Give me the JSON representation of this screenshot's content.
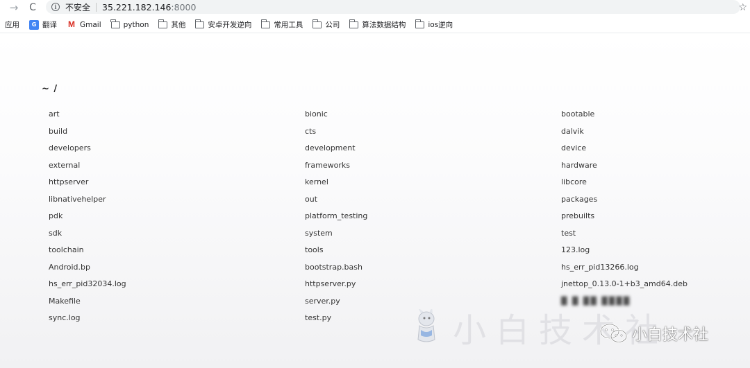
{
  "browser": {
    "forward_icon": "→",
    "reload_icon": "C",
    "info_icon": "i",
    "insecure_label": "不安全",
    "url_host": "35.221.182.146",
    "url_port": ":8000",
    "star_icon": "☆"
  },
  "bookmarks": [
    {
      "label": "应用",
      "icon": "none"
    },
    {
      "label": "翻译",
      "icon": "translate-icon"
    },
    {
      "label": "Gmail",
      "icon": "gmail-icon"
    },
    {
      "label": "python",
      "icon": "folder-icon"
    },
    {
      "label": "其他",
      "icon": "folder-icon"
    },
    {
      "label": "安卓开发逆向",
      "icon": "folder-icon"
    },
    {
      "label": "常用工具",
      "icon": "folder-icon"
    },
    {
      "label": "公司",
      "icon": "folder-icon"
    },
    {
      "label": "算法数据结构",
      "icon": "folder-icon"
    },
    {
      "label": "ios逆向",
      "icon": "folder-icon"
    }
  ],
  "page": {
    "title": "~ /",
    "entries": [
      "art",
      "bionic",
      "bootable",
      "build",
      "cts",
      "dalvik",
      "developers",
      "development",
      "device",
      "external",
      "frameworks",
      "hardware",
      "httpserver",
      "kernel",
      "libcore",
      "libnativehelper",
      "out",
      "packages",
      "pdk",
      "platform_testing",
      "prebuilts",
      "sdk",
      "system",
      "test",
      "toolchain",
      "tools",
      "123.log",
      "Android.bp",
      "bootstrap.bash",
      "hs_err_pid13266.log",
      "hs_err_pid32034.log",
      "httpserver.py",
      "jnettop_0.13.0-1+b3_amd64.deb",
      "Makefile",
      "server.py",
      "",
      "sync.log",
      "test.py"
    ]
  },
  "watermark": {
    "big_text": "小白技术社",
    "small_text": "小白技术社"
  }
}
